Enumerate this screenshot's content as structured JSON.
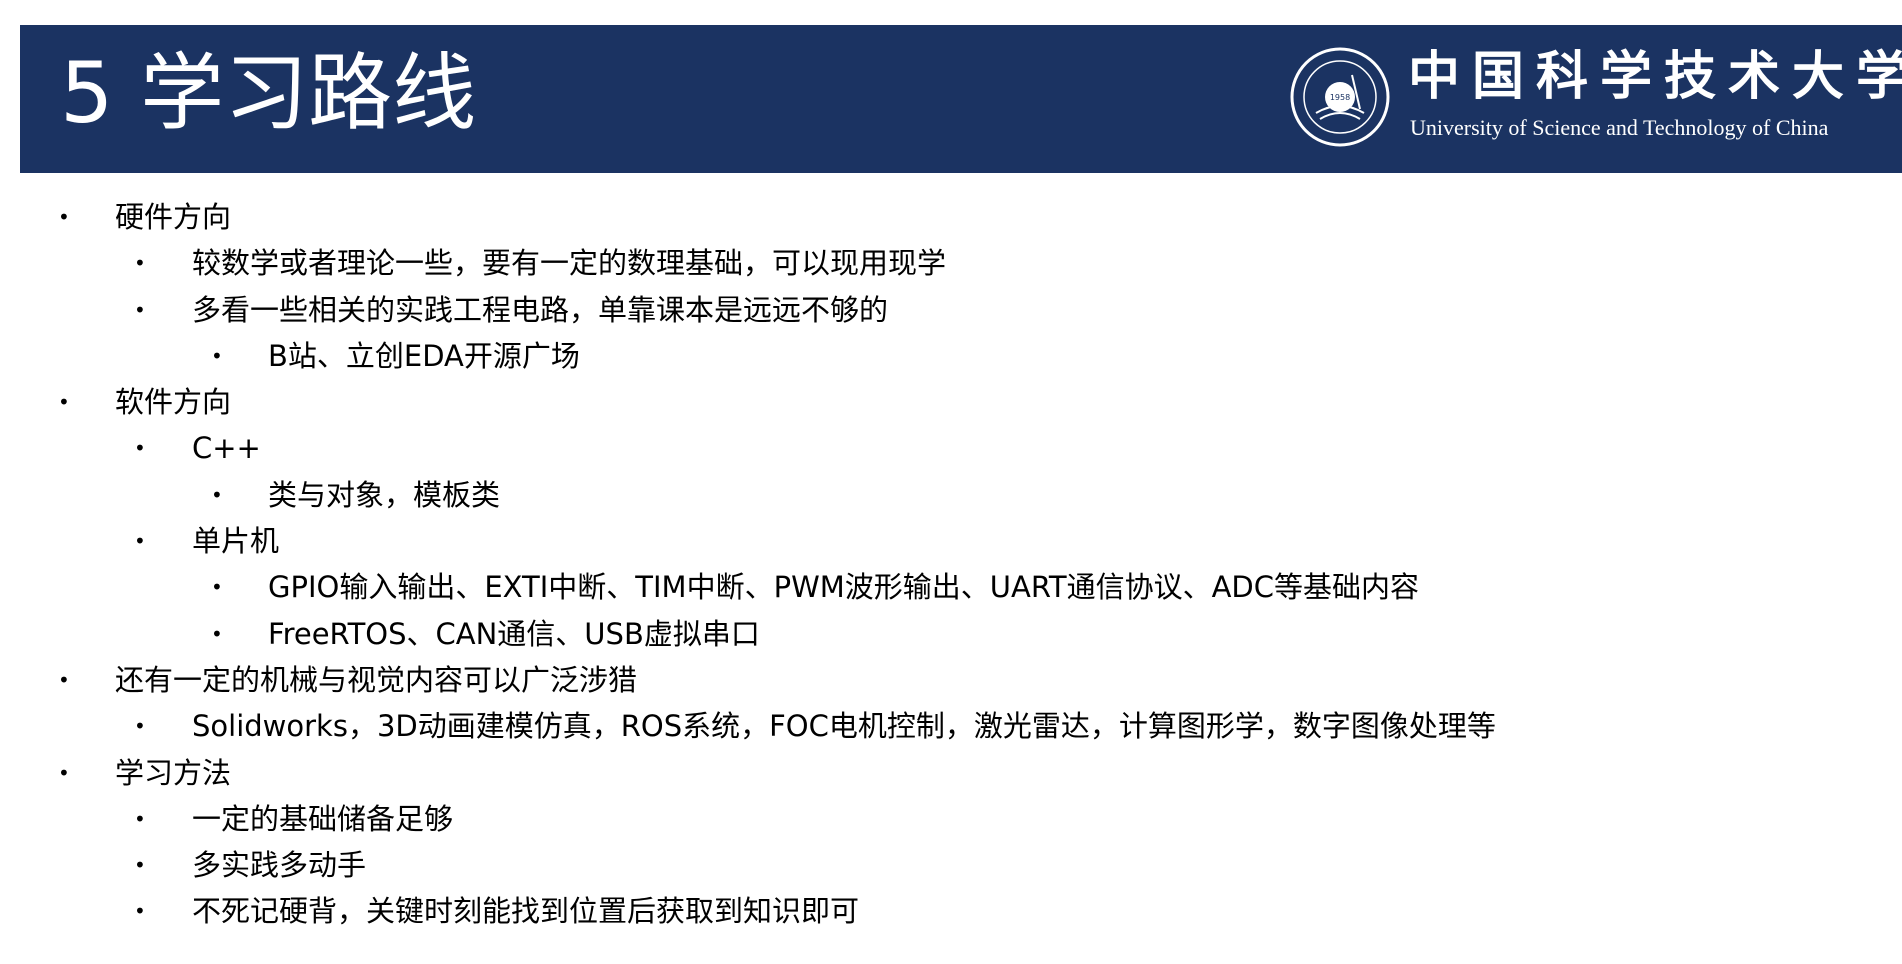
{
  "header": {
    "title": "5 学习路线",
    "bg_color": "#1b3362",
    "logo": {
      "name_cn": "中国科学技术大学",
      "name_en": "University of Science and Technology of China",
      "seal_year": "1958"
    }
  },
  "content": {
    "items": [
      {
        "level": 1,
        "text": "硬件方向"
      },
      {
        "level": 2,
        "text": "较数学或者理论一些，要有一定的数理基础，可以现用现学"
      },
      {
        "level": 2,
        "text": "多看一些相关的实践工程电路，单靠课本是远远不够的"
      },
      {
        "level": 3,
        "text": "B站、立创EDA开源广场"
      },
      {
        "level": 1,
        "text": "软件方向"
      },
      {
        "level": 2,
        "text": "C++"
      },
      {
        "level": 3,
        "text": "类与对象，模板类"
      },
      {
        "level": 2,
        "text": "单片机"
      },
      {
        "level": 3,
        "text": "GPIO输入输出、EXTI中断、TIM中断、PWM波形输出、UART通信协议、ADC等基础内容"
      },
      {
        "level": 3,
        "text": "FreeRTOS、CAN通信、USB虚拟串口"
      },
      {
        "level": 1,
        "text": "还有一定的机械与视觉内容可以广泛涉猎"
      },
      {
        "level": 2,
        "text": "Solidworks，3D动画建模仿真，ROS系统，FOC电机控制，激光雷达，计算图形学，数字图像处理等"
      },
      {
        "level": 1,
        "text": "学习方法"
      },
      {
        "level": 2,
        "text": "一定的基础储备足够"
      },
      {
        "level": 2,
        "text": "多实践多动手"
      },
      {
        "level": 2,
        "text": "不死记硬背，关键时刻能找到位置后获取到知识即可"
      }
    ]
  }
}
